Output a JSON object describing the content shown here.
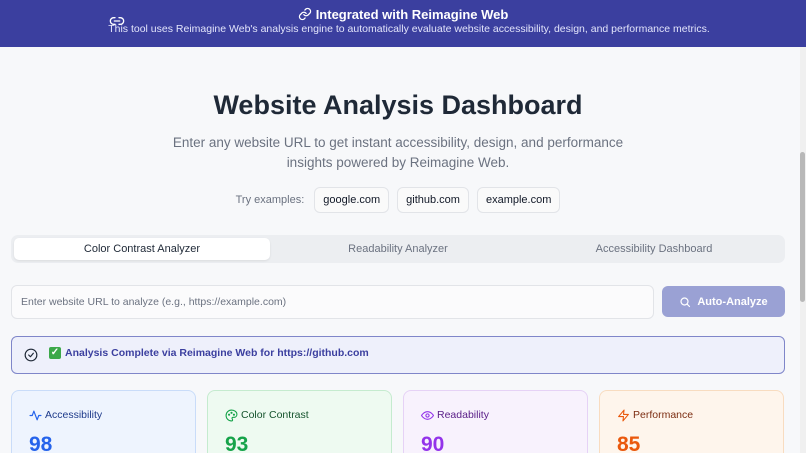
{
  "banner": {
    "title": "Integrated with Reimagine Web",
    "description": "This tool uses Reimagine Web's analysis engine to automatically evaluate website accessibility, design, and performance metrics.",
    "link_icon": "link-icon",
    "title_icon": "link-icon"
  },
  "hero": {
    "title": "Website Analysis Dashboard",
    "subtitle": "Enter any website URL to get instant accessibility, design, and performance insights powered by Reimagine Web."
  },
  "examples": {
    "label": "Try examples:",
    "items": [
      "google.com",
      "github.com",
      "example.com"
    ]
  },
  "tabs": [
    {
      "label": "Color Contrast Analyzer",
      "active": true
    },
    {
      "label": "Readability Analyzer",
      "active": false
    },
    {
      "label": "Accessibility Dashboard",
      "active": false
    }
  ],
  "search": {
    "placeholder": "Enter website URL to analyze (e.g., https://example.com)",
    "value": "",
    "button_label": "Auto-Analyze",
    "button_icon": "search-icon"
  },
  "status": {
    "check_icon": "check-circle-icon",
    "badge": "✓",
    "text": "Analysis Complete via Reimagine Web for https://github.com"
  },
  "metrics": [
    {
      "label": "Accessibility",
      "value": "98",
      "icon": "activity-icon",
      "color": "#2563eb"
    },
    {
      "label": "Color Contrast",
      "value": "93",
      "icon": "palette-icon",
      "color": "#16a34a"
    },
    {
      "label": "Readability",
      "value": "90",
      "icon": "eye-icon",
      "color": "#9333ea"
    },
    {
      "label": "Performance",
      "value": "85",
      "icon": "zap-icon",
      "color": "#ea580c"
    }
  ],
  "colors": {
    "banner": "#3b3f9f",
    "accent": "#9aa1d4"
  }
}
